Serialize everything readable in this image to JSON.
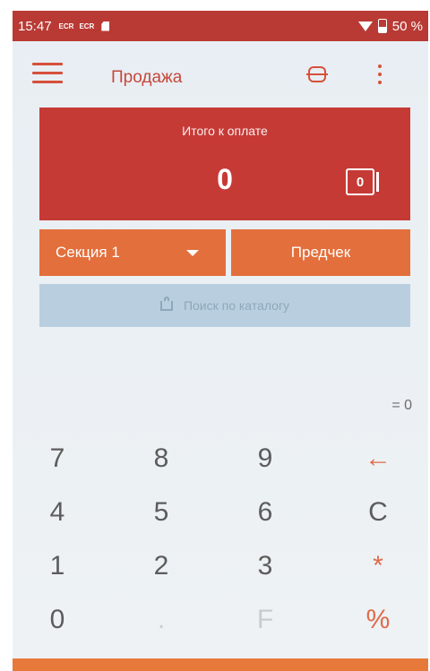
{
  "status_bar": {
    "time": "15:47",
    "ecr1": "ECR",
    "ecr2": "ECR",
    "battery": "50 %"
  },
  "toolbar": {
    "title": "Продажа"
  },
  "total": {
    "label": "Итого к оплате",
    "value": "0",
    "item_count": "0"
  },
  "buttons": {
    "section": "Секция 1",
    "precheck": "Предчек"
  },
  "catalog": {
    "placeholder": "Поиск по каталогу"
  },
  "expression": "= 0",
  "keypad": {
    "rows": [
      [
        "7",
        "8",
        "9",
        "←"
      ],
      [
        "4",
        "5",
        "6",
        "C"
      ],
      [
        "1",
        "2",
        "3",
        "*"
      ],
      [
        "0",
        ".",
        "F",
        "%"
      ]
    ]
  },
  "colors": {
    "status_bar": "#b93a34",
    "total_panel": "#c63a36",
    "accent_button": "#e36f3c",
    "catalog_bar": "#b9cfdf"
  }
}
